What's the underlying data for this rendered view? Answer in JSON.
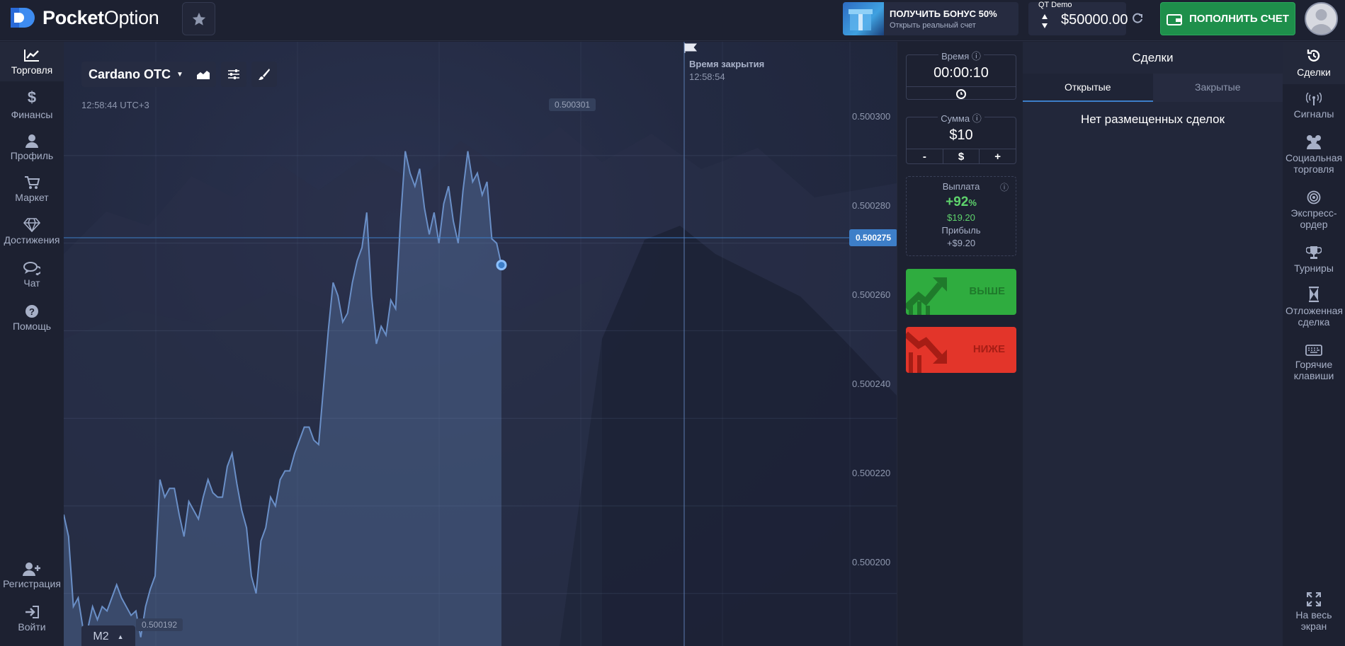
{
  "brand": {
    "name_bold": "Pocket",
    "name_thin": "Option"
  },
  "promo": {
    "title": "ПОЛУЧИТЬ БОНУС 50%",
    "subtitle": "Открыть реальный счет"
  },
  "account": {
    "type": "QT Demo",
    "balance": "$50000.00"
  },
  "deposit": {
    "label": "ПОПОЛНИТЬ СЧЕТ"
  },
  "left_nav": [
    {
      "label": "Торговля",
      "icon": "chart-line-icon"
    },
    {
      "label": "Финансы",
      "icon": "dollar-icon"
    },
    {
      "label": "Профиль",
      "icon": "user-icon"
    },
    {
      "label": "Маркет",
      "icon": "cart-icon"
    },
    {
      "label": "Достижения",
      "icon": "diamond-icon"
    },
    {
      "label": "Чат",
      "icon": "chat-icon"
    },
    {
      "label": "Помощь",
      "icon": "help-icon"
    },
    {
      "label": "Регистрация",
      "icon": "user-plus-icon"
    },
    {
      "label": "Войти",
      "icon": "sign-in-icon"
    }
  ],
  "chart": {
    "asset": "Cardano OTC",
    "server_time": "12:58:44 UTC+3",
    "expiry_title": "Время закрытия",
    "expiry_time": "12:58:54",
    "max_badge": "0.500301",
    "min_badge": "0.500192",
    "current_price": "0.500275",
    "price_levels": [
      "0.500300",
      "0.500280",
      "0.500260",
      "0.500240",
      "0.500220",
      "0.500200"
    ],
    "timeframe": "M2"
  },
  "chart_data": {
    "type": "area",
    "ylim": [
      0.500188,
      0.500326
    ],
    "values": [
      0.500218,
      0.500213,
      0.500197,
      0.500199,
      0.500192,
      0.500192,
      0.500197,
      0.500194,
      0.500197,
      0.500196,
      0.500199,
      0.500202,
      0.500199,
      0.500197,
      0.500195,
      0.500196,
      0.50019,
      0.500197,
      0.500201,
      0.500204,
      0.500226,
      0.500222,
      0.500224,
      0.500224,
      0.500218,
      0.500213,
      0.500221,
      0.500219,
      0.500217,
      0.500222,
      0.500226,
      0.500223,
      0.500222,
      0.500222,
      0.500229,
      0.500232,
      0.500225,
      0.500219,
      0.500215,
      0.500204,
      0.5002,
      0.500212,
      0.500215,
      0.500222,
      0.50022,
      0.500226,
      0.500228,
      0.500228,
      0.500232,
      0.500235,
      0.500238,
      0.500238,
      0.500235,
      0.500234,
      0.500247,
      0.50026,
      0.500271,
      0.500268,
      0.500262,
      0.500264,
      0.500271,
      0.500276,
      0.500279,
      0.500287,
      0.500268,
      0.500257,
      0.500261,
      0.500259,
      0.500267,
      0.500265,
      0.500285,
      0.500301,
      0.500296,
      0.500293,
      0.500297,
      0.500288,
      0.500282,
      0.500287,
      0.50028,
      0.500289,
      0.500293,
      0.500285,
      0.50028,
      0.500292,
      0.500301,
      0.500294,
      0.500296,
      0.500291,
      0.500294,
      0.500281,
      0.50028,
      0.500275
    ]
  },
  "trade_panel": {
    "time_label": "Время",
    "time_value": "00:00:10",
    "amount_label": "Сумма",
    "amount_value": "$10",
    "minus": "-",
    "currency": "$",
    "plus": "+",
    "payout_label": "Выплата",
    "payout_pct": "+92",
    "payout_pct_sign": "%",
    "payout_value": "$19.20",
    "profit_label": "Прибыль",
    "profit_value": "+$9.20",
    "buy_label": "ВЫШЕ",
    "sell_label": "НИЖЕ"
  },
  "deals": {
    "title": "Сделки",
    "tab_open": "Открытые",
    "tab_closed": "Закрытые",
    "empty": "Нет размещенных сделок"
  },
  "right_nav": [
    {
      "label": "Сделки",
      "icon": "history-icon"
    },
    {
      "label": "Сигналы",
      "icon": "signal-icon"
    },
    {
      "label": "Социальная торговля",
      "icon": "users-icon"
    },
    {
      "label": "Экспресс-ордер",
      "icon": "target-icon"
    },
    {
      "label": "Турниры",
      "icon": "trophy-icon"
    },
    {
      "label": "Отложенная сделка",
      "icon": "hourglass-icon"
    },
    {
      "label": "Горячие клавиши",
      "icon": "keyboard-icon"
    },
    {
      "label": "На весь экран",
      "icon": "fullscreen-icon"
    }
  ],
  "colors": {
    "accent": "#3d7ec8",
    "buy": "#2fac3f",
    "sell": "#e3352a",
    "deposit": "#1e8f4b"
  }
}
